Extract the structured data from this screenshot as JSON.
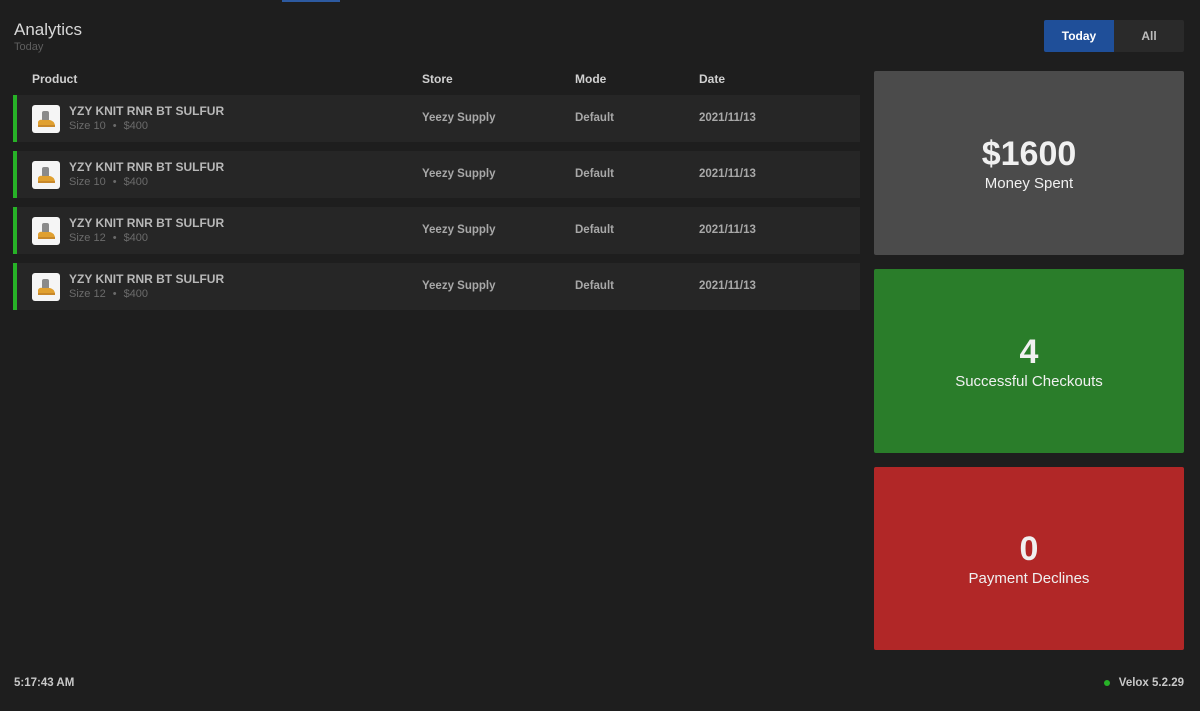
{
  "header": {
    "title": "Analytics",
    "subtitle": "Today"
  },
  "filter": {
    "options": [
      "Today",
      "All"
    ],
    "selected": "Today"
  },
  "table": {
    "headers": {
      "product": "Product",
      "store": "Store",
      "mode": "Mode",
      "date": "Date"
    },
    "rows": [
      {
        "name": "YZY KNIT RNR BT SULFUR",
        "size": "Size 10",
        "price": "$400",
        "store": "Yeezy Supply",
        "mode": "Default",
        "date": "2021/11/13",
        "status": "success"
      },
      {
        "name": "YZY KNIT RNR BT SULFUR",
        "size": "Size 10",
        "price": "$400",
        "store": "Yeezy Supply",
        "mode": "Default",
        "date": "2021/11/13",
        "status": "success"
      },
      {
        "name": "YZY KNIT RNR BT SULFUR",
        "size": "Size 12",
        "price": "$400",
        "store": "Yeezy Supply",
        "mode": "Default",
        "date": "2021/11/13",
        "status": "success"
      },
      {
        "name": "YZY KNIT RNR BT SULFUR",
        "size": "Size 12",
        "price": "$400",
        "store": "Yeezy Supply",
        "mode": "Default",
        "date": "2021/11/13",
        "status": "success"
      }
    ]
  },
  "stats": {
    "money": {
      "value": "$1600",
      "label": "Money Spent",
      "color": "#4b4b4b"
    },
    "checkouts": {
      "value": "4",
      "label": "Successful Checkouts",
      "color": "#2a7d2a"
    },
    "declines": {
      "value": "0",
      "label": "Payment Declines",
      "color": "#b12727"
    }
  },
  "footer": {
    "time": "5:17:43 AM",
    "version": "Velox 5.2.29",
    "status_color": "#27b227"
  },
  "icons": {
    "product_thumb": "sneaker-icon",
    "status_dot": "status-dot-icon",
    "separator": "•"
  },
  "colors": {
    "accent": "#1f4f99",
    "success": "#27b227"
  }
}
